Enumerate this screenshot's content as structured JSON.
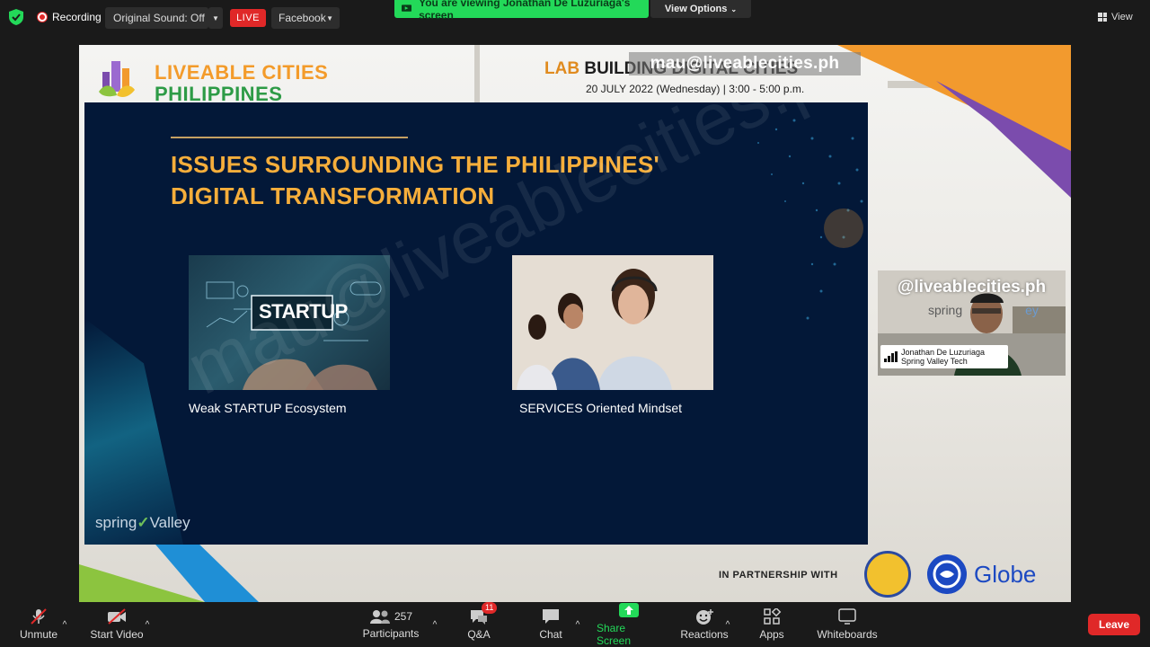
{
  "topbar": {
    "recording_label": "Recording",
    "original_sound_label": "Original Sound: Off",
    "live_label": "LIVE",
    "facebook_label": "Facebook",
    "viewing_label": "You are viewing Jonathan De Luzuriaga's screen",
    "view_options_label": "View Options",
    "view_label": "View"
  },
  "shared_screen": {
    "brand_line1": "LIVEABLE CITIES",
    "brand_line2": "PHILIPPINES",
    "event_lab": "LAB",
    "event_title": "BUILDING DIGITAL CITIES",
    "event_date": "20 JULY 2022 (Wednesday) | 3:00 - 5:00 p.m.",
    "email_watermark": "mau@liveablecities.ph",
    "diagonal_watermark": "mau@liveablecities.ph",
    "partnership_label": "IN PARTNERSHIP WITH",
    "globe_label": "Globe",
    "slide": {
      "title_line1": "ISSUES SURROUNDING THE PHILIPPINES'",
      "title_line2": "DIGITAL TRANSFORMATION",
      "image1_label": "STARTUP",
      "caption1": "Weak STARTUP Ecosystem",
      "caption2": "SERVICES Oriented Mindset",
      "footer_logo_a": "spring",
      "footer_logo_b": "Valley"
    }
  },
  "speaker": {
    "handle": "@liveablecities.ph",
    "background_text": "spring",
    "background_text2": "ey",
    "name": "Jonathan De Luzuriaga",
    "company": "Spring Valley Tech"
  },
  "toolbar": {
    "unmute": "Unmute",
    "start_video": "Start Video",
    "participants": "Participants",
    "participants_count": "257",
    "qa": "Q&A",
    "qa_badge": "11",
    "chat": "Chat",
    "share_screen": "Share Screen",
    "reactions": "Reactions",
    "apps": "Apps",
    "whiteboards": "Whiteboards",
    "leave": "Leave"
  },
  "colors": {
    "accent_green": "#23d959",
    "live_red": "#e02828",
    "slide_bg": "#031838",
    "slide_title": "#f6ae3b"
  }
}
